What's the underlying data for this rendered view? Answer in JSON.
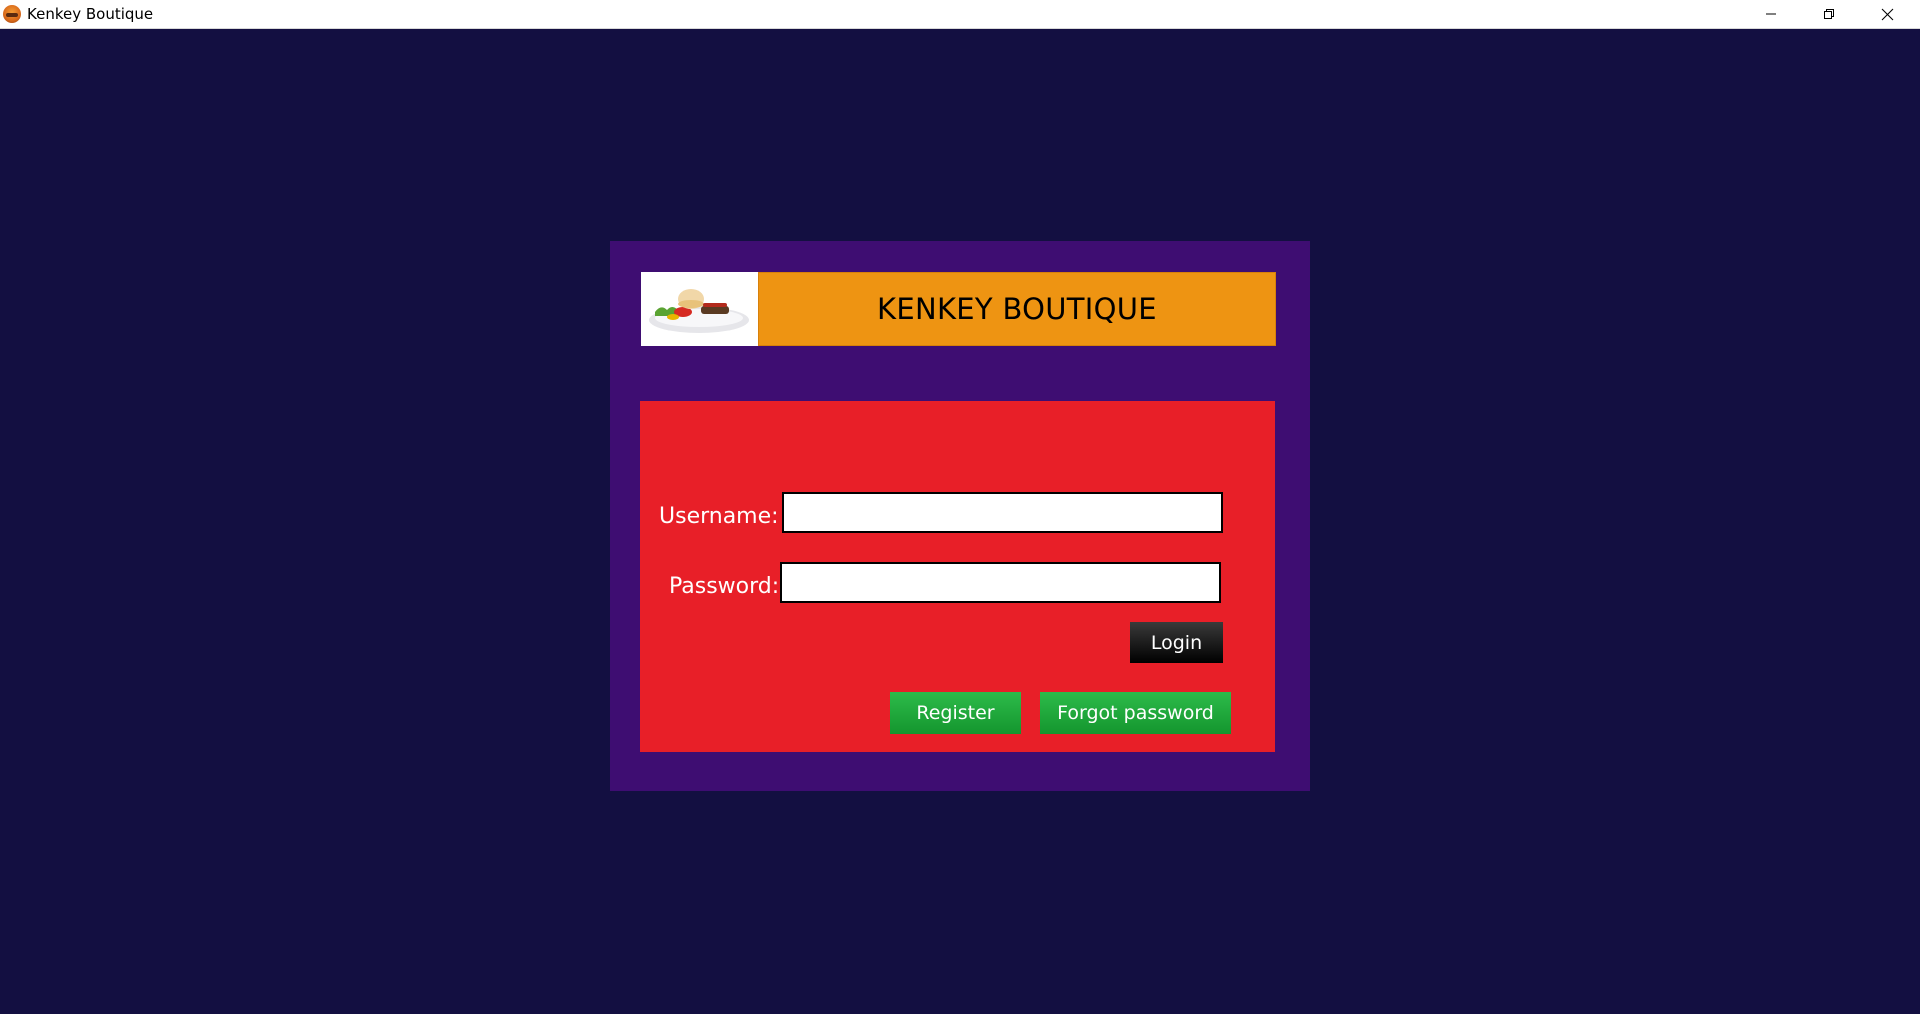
{
  "window": {
    "title": "Kenkey Boutique",
    "app_icon": "food-plate-icon",
    "controls": {
      "minimize": "minimize-icon",
      "maximize": "restore-icon",
      "close": "close-icon"
    }
  },
  "banner": {
    "title": "KENKEY BOUTIQUE",
    "logo": "burger-plate-logo"
  },
  "form": {
    "username_label": "Username:",
    "username_value": "",
    "password_label": "Password:",
    "password_value": "",
    "login_label": "Login",
    "register_label": "Register",
    "forgot_label": "Forgot password"
  },
  "colors": {
    "background": "#130f41",
    "frame": "#3e0d72",
    "banner": "#ee9412",
    "panel": "#e81f28",
    "login_button": "#000000",
    "green_button": "#1fa83a"
  }
}
